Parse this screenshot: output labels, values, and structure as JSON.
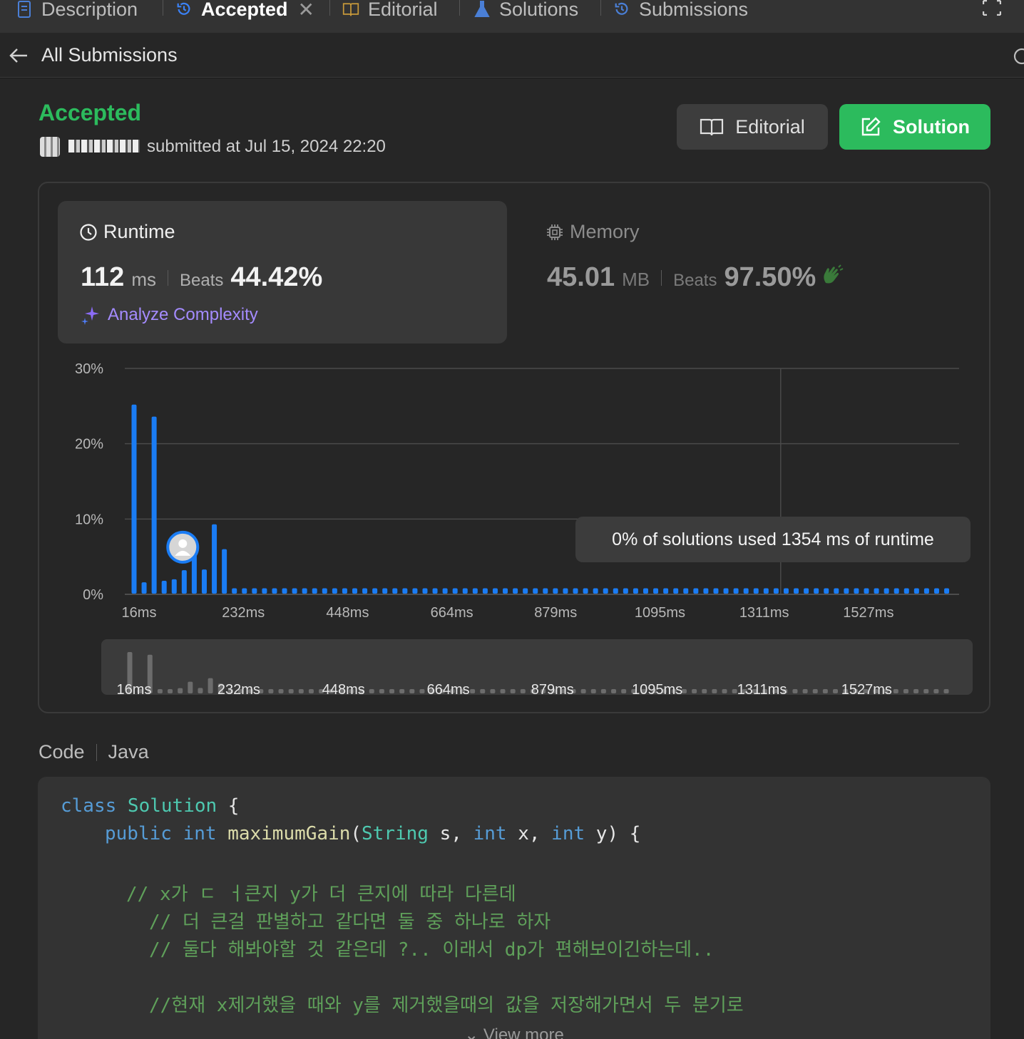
{
  "tabs": [
    {
      "label": "Description",
      "icon": "description-icon"
    },
    {
      "label": "Accepted",
      "icon": "history-icon",
      "active": true,
      "closable": true
    },
    {
      "label": "Editorial",
      "icon": "book-icon"
    },
    {
      "label": "Solutions",
      "icon": "flask-icon"
    },
    {
      "label": "Submissions",
      "icon": "history-icon"
    }
  ],
  "subheader": {
    "title": "All Submissions"
  },
  "submission": {
    "status": "Accepted",
    "submitted_text": "submitted at Jul 15, 2024 22:20",
    "editorial_label": "Editorial",
    "solution_label": "Solution"
  },
  "runtime": {
    "title": "Runtime",
    "value": "112",
    "unit": "ms",
    "beats_label": "Beats",
    "beats_value": "44.42%",
    "analyze_label": "Analyze Complexity"
  },
  "memory": {
    "title": "Memory",
    "value": "45.01",
    "unit": "MB",
    "beats_label": "Beats",
    "beats_value": "97.50%"
  },
  "tooltip": "0% of solutions used 1354 ms of runtime",
  "colors": {
    "accent_green": "#2cbb5d",
    "bar_blue": "#1a7cf4",
    "analyze_purple": "#a48bff"
  },
  "chart_data": {
    "type": "bar",
    "y_ticks": [
      "30%",
      "20%",
      "10%",
      "0%"
    ],
    "ylim": [
      0,
      30
    ],
    "x_tick_labels": [
      "16ms",
      "232ms",
      "448ms",
      "664ms",
      "879ms",
      "1095ms",
      "1311ms",
      "1527ms"
    ],
    "xlim": [
      16,
      1700
    ],
    "values": [
      25.2,
      1.6,
      23.6,
      1.8,
      2.0,
      3.2,
      7.1,
      3.3,
      9.3,
      6.0,
      0.8,
      0.8,
      0.8,
      0.8,
      0.8,
      0.8,
      0.8,
      0.8,
      0.8,
      0.8,
      0.8,
      0.8,
      0.8,
      0.8,
      0.8,
      0.8,
      0.8,
      0.8,
      0.8,
      0.8,
      0.8,
      0.8,
      0.8,
      0.8,
      0.8,
      0.8,
      0.8,
      0.8,
      0.8,
      0.8,
      0.8,
      0.8,
      0.8,
      0.8,
      0.8,
      0.8,
      0.8,
      0.8,
      0.8,
      0.8,
      0.8,
      0.8,
      0.8,
      0.8,
      0.8,
      0.8,
      0.8,
      0.8,
      0.8,
      0.8,
      0.8,
      0.8,
      0.8,
      0.8,
      0.8,
      0.8,
      0.8,
      0.8,
      0.8,
      0.8,
      0.8,
      0.8,
      0.8,
      0.8,
      0.8,
      0.8,
      0.8,
      0.8,
      0.8,
      0.8,
      0.8,
      0.8
    ],
    "user_marker_bar_index": 4,
    "highlight_x_ms": 1354,
    "grid": true
  },
  "code": {
    "label": "Code",
    "language": "Java",
    "view_more": "View more",
    "lines": [
      {
        "indent": 0,
        "tokens": [
          [
            "kw",
            "class "
          ],
          [
            "cls",
            "Solution"
          ],
          [
            "",
            " {"
          ]
        ]
      },
      {
        "indent": 1,
        "tokens": [
          [
            "kw",
            "public int "
          ],
          [
            "fn",
            "maximumGain"
          ],
          [
            "",
            "("
          ],
          [
            "cls",
            "String"
          ],
          [
            "",
            " s, "
          ],
          [
            "kw",
            "int"
          ],
          [
            "",
            " x, "
          ],
          [
            "kw",
            "int"
          ],
          [
            "",
            " y) {"
          ]
        ]
      },
      {
        "indent": 0,
        "tokens": []
      },
      {
        "indent": 2,
        "tokens": [
          [
            "cm",
            "// x가 ㄷ ㅓ큰지 y가 더 큰지에 따라 다른데"
          ]
        ]
      },
      {
        "indent": 3,
        "tokens": [
          [
            "cm",
            "// 더 큰걸 판별하고 같다면 둘 중 하나로 하자"
          ]
        ]
      },
      {
        "indent": 3,
        "tokens": [
          [
            "cm",
            "// 둘다 해봐야할 것 같은데 ?.. 이래서 dp가 편해보이긴하는데.."
          ]
        ]
      },
      {
        "indent": 0,
        "tokens": []
      },
      {
        "indent": 3,
        "tokens": [
          [
            "cm",
            "//현재 x제거했을 때와 y를 제거했을때의 값을 저장해가면서 두 분기로"
          ]
        ]
      }
    ]
  }
}
